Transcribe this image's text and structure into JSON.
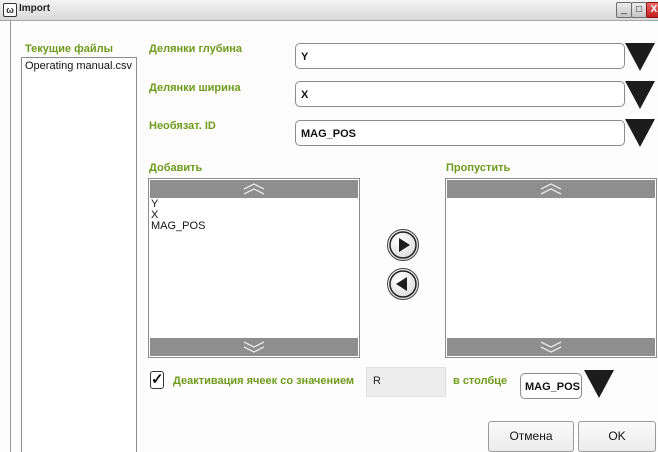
{
  "window": {
    "title": "Import",
    "app_icon_glyph": "ω",
    "minimize_glyph": "_",
    "maximize_glyph": "□",
    "close_glyph": "X"
  },
  "files": {
    "heading": "Текущие файлы",
    "items": [
      "Operating manual.csv"
    ]
  },
  "fields": {
    "depth": {
      "label": "Делянки глубина",
      "value": "Y"
    },
    "width": {
      "label": "Делянки ширина",
      "value": "X"
    },
    "optional_id": {
      "label": "Необязат. ID",
      "value": "MAG_POS"
    }
  },
  "lists": {
    "add": {
      "label": "Добавить",
      "items": [
        "Y",
        "X",
        "MAG_POS"
      ]
    },
    "skip": {
      "label": "Пропустить",
      "items": []
    }
  },
  "deactivate": {
    "checked": true,
    "check_glyph": "✓",
    "label": "Деактивация ячеек со значением",
    "value": "R",
    "column_label": "в столбце",
    "column_value": "MAG_POS"
  },
  "buttons": {
    "cancel": "Отмена",
    "ok": "OK"
  },
  "colors": {
    "label_green": "#6f9b1c",
    "scrollbar_gray": "#8e8e8e",
    "arrow_black": "#1c1c1c"
  },
  "icons": {
    "move_right": "arrow-right-circle-icon",
    "move_left": "arrow-left-circle-icon",
    "scroll_up": "chevron-double-up-icon",
    "scroll_down": "chevron-double-down-icon",
    "dropdown": "triangle-down-icon"
  }
}
